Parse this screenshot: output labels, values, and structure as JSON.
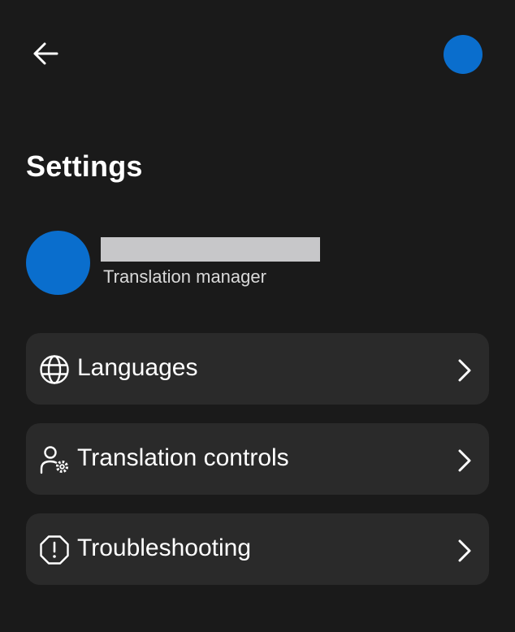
{
  "colors": {
    "background": "#1a1a1a",
    "card": "#2a2a2a",
    "accent": "#0a6ecd",
    "text": "#ffffff",
    "subtext": "#d9d9d9",
    "redaction": "#c7c7c9"
  },
  "header": {
    "back_icon": "arrow-left-icon",
    "avatar_icon": "avatar-circle"
  },
  "page": {
    "title": "Settings"
  },
  "profile": {
    "name": "",
    "name_redacted": true,
    "role": "Translation manager"
  },
  "menu": {
    "items": [
      {
        "label": "Languages",
        "icon": "globe-icon"
      },
      {
        "label": "Translation controls",
        "icon": "person-gear-icon"
      },
      {
        "label": "Troubleshooting",
        "icon": "alert-octagon-icon"
      }
    ],
    "chevron_icon": "chevron-right-icon"
  }
}
